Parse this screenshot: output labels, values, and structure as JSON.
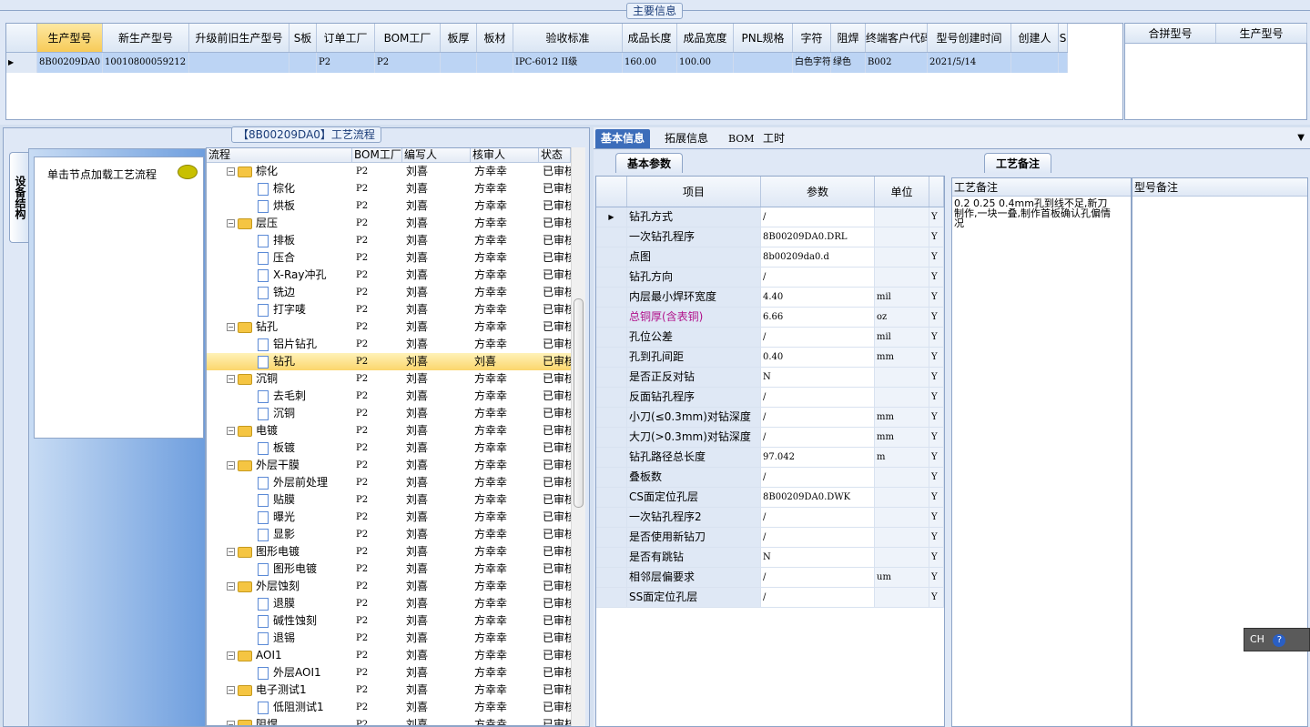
{
  "main_info": {
    "title": "主要信息",
    "columns": [
      "生产型号",
      "新生产型号",
      "升级前旧生产型号",
      "S板",
      "订单工厂",
      "BOM工厂",
      "板厚",
      "板材",
      "验收标准",
      "成品长度",
      "成品宽度",
      "PNL规格",
      "字符",
      "阻焊",
      "终端客户代码",
      "型号创建时间",
      "创建人",
      "S"
    ],
    "row": [
      "8B00209DA0",
      "10010800059212",
      "",
      "",
      "P2",
      "P2",
      "",
      "",
      "IPC-6012 II级",
      "160.00",
      "100.00",
      "",
      "白色字符",
      "绿色",
      "B002",
      "2021/5/14",
      "",
      ""
    ]
  },
  "merge": {
    "columns": [
      "合拼型号",
      "生产型号"
    ]
  },
  "process_flow": {
    "title": "【8B00209DA0】工艺流程",
    "side_tab": "设备结构",
    "hint": "单击节点加载工艺流程",
    "headers": [
      "流程",
      "BOM工厂",
      "编写人",
      "核审人",
      "状态"
    ],
    "rows": [
      {
        "name": "棕化",
        "level": 0,
        "factory": "P2",
        "writer": "刘喜",
        "reviewer": "方幸幸",
        "status": "已审核"
      },
      {
        "name": "棕化",
        "level": 1,
        "factory": "P2",
        "writer": "刘喜",
        "reviewer": "方幸幸",
        "status": "已审核"
      },
      {
        "name": "烘板",
        "level": 1,
        "factory": "P2",
        "writer": "刘喜",
        "reviewer": "方幸幸",
        "status": "已审核"
      },
      {
        "name": "层压",
        "level": 0,
        "factory": "P2",
        "writer": "刘喜",
        "reviewer": "方幸幸",
        "status": "已审核"
      },
      {
        "name": "排板",
        "level": 1,
        "factory": "P2",
        "writer": "刘喜",
        "reviewer": "方幸幸",
        "status": "已审核"
      },
      {
        "name": "压合",
        "level": 1,
        "factory": "P2",
        "writer": "刘喜",
        "reviewer": "方幸幸",
        "status": "已审核"
      },
      {
        "name": "X-Ray冲孔",
        "level": 1,
        "factory": "P2",
        "writer": "刘喜",
        "reviewer": "方幸幸",
        "status": "已审核"
      },
      {
        "name": "铣边",
        "level": 1,
        "factory": "P2",
        "writer": "刘喜",
        "reviewer": "方幸幸",
        "status": "已审核"
      },
      {
        "name": "打字唛",
        "level": 1,
        "factory": "P2",
        "writer": "刘喜",
        "reviewer": "方幸幸",
        "status": "已审核"
      },
      {
        "name": "钻孔",
        "level": 0,
        "factory": "P2",
        "writer": "刘喜",
        "reviewer": "方幸幸",
        "status": "已审核"
      },
      {
        "name": "铝片钻孔",
        "level": 1,
        "factory": "P2",
        "writer": "刘喜",
        "reviewer": "方幸幸",
        "status": "已审核"
      },
      {
        "name": "钻孔",
        "level": 1,
        "factory": "P2",
        "writer": "刘喜",
        "reviewer": "刘喜",
        "status": "已审核",
        "selected": true
      },
      {
        "name": "沉铜",
        "level": 0,
        "factory": "P2",
        "writer": "刘喜",
        "reviewer": "方幸幸",
        "status": "已审核"
      },
      {
        "name": "去毛刺",
        "level": 1,
        "factory": "P2",
        "writer": "刘喜",
        "reviewer": "方幸幸",
        "status": "已审核"
      },
      {
        "name": "沉铜",
        "level": 1,
        "factory": "P2",
        "writer": "刘喜",
        "reviewer": "方幸幸",
        "status": "已审核"
      },
      {
        "name": "电镀",
        "level": 0,
        "factory": "P2",
        "writer": "刘喜",
        "reviewer": "方幸幸",
        "status": "已审核"
      },
      {
        "name": "板镀",
        "level": 1,
        "factory": "P2",
        "writer": "刘喜",
        "reviewer": "方幸幸",
        "status": "已审核"
      },
      {
        "name": "外层干膜",
        "level": 0,
        "factory": "P2",
        "writer": "刘喜",
        "reviewer": "方幸幸",
        "status": "已审核"
      },
      {
        "name": "外层前处理",
        "level": 1,
        "factory": "P2",
        "writer": "刘喜",
        "reviewer": "方幸幸",
        "status": "已审核"
      },
      {
        "name": "贴膜",
        "level": 1,
        "factory": "P2",
        "writer": "刘喜",
        "reviewer": "方幸幸",
        "status": "已审核"
      },
      {
        "name": "曝光",
        "level": 1,
        "factory": "P2",
        "writer": "刘喜",
        "reviewer": "方幸幸",
        "status": "已审核"
      },
      {
        "name": "显影",
        "level": 1,
        "factory": "P2",
        "writer": "刘喜",
        "reviewer": "方幸幸",
        "status": "已审核"
      },
      {
        "name": "图形电镀",
        "level": 0,
        "factory": "P2",
        "writer": "刘喜",
        "reviewer": "方幸幸",
        "status": "已审核"
      },
      {
        "name": "图形电镀",
        "level": 1,
        "factory": "P2",
        "writer": "刘喜",
        "reviewer": "方幸幸",
        "status": "已审核"
      },
      {
        "name": "外层蚀刻",
        "level": 0,
        "factory": "P2",
        "writer": "刘喜",
        "reviewer": "方幸幸",
        "status": "已审核"
      },
      {
        "name": "退膜",
        "level": 1,
        "factory": "P2",
        "writer": "刘喜",
        "reviewer": "方幸幸",
        "status": "已审核"
      },
      {
        "name": "碱性蚀刻",
        "level": 1,
        "factory": "P2",
        "writer": "刘喜",
        "reviewer": "方幸幸",
        "status": "已审核"
      },
      {
        "name": "退锡",
        "level": 1,
        "factory": "P2",
        "writer": "刘喜",
        "reviewer": "方幸幸",
        "status": "已审核"
      },
      {
        "name": "AOI1",
        "level": 0,
        "factory": "P2",
        "writer": "刘喜",
        "reviewer": "方幸幸",
        "status": "已审核"
      },
      {
        "name": "外层AOI1",
        "level": 1,
        "factory": "P2",
        "writer": "刘喜",
        "reviewer": "方幸幸",
        "status": "已审核"
      },
      {
        "name": "电子测试1",
        "level": 0,
        "factory": "P2",
        "writer": "刘喜",
        "reviewer": "方幸幸",
        "status": "已审核"
      },
      {
        "name": "低阻测试1",
        "level": 1,
        "factory": "P2",
        "writer": "刘喜",
        "reviewer": "方幸幸",
        "status": "已审核"
      },
      {
        "name": "阻焊",
        "level": 0,
        "factory": "P2",
        "writer": "刘喜",
        "reviewer": "方幸幸",
        "status": "已审核"
      }
    ]
  },
  "tabs": [
    "基本信息",
    "拓展信息",
    "BOM",
    "工时"
  ],
  "basic_params": {
    "title": "基本参数",
    "headers": [
      "项目",
      "参数",
      "单位"
    ],
    "rows": [
      {
        "item": "钻孔方式",
        "value": "/",
        "unit": "",
        "flag": "Y"
      },
      {
        "item": "一次钻孔程序",
        "value": "8B00209DA0.DRL",
        "unit": "",
        "flag": "Y"
      },
      {
        "item": "点图",
        "value": "8b00209da0.d",
        "unit": "",
        "flag": "Y"
      },
      {
        "item": "钻孔方向",
        "value": "/",
        "unit": "",
        "flag": "Y"
      },
      {
        "item": "内层最小焊环宽度",
        "value": "4.40",
        "unit": "mil",
        "flag": "Y"
      },
      {
        "item": "总铜厚(含表铜)",
        "value": "6.66",
        "unit": "oz",
        "flag": "Y",
        "highlight": true
      },
      {
        "item": "孔位公差",
        "value": "/",
        "unit": "mil",
        "flag": "Y"
      },
      {
        "item": "孔到孔间距",
        "value": "0.40",
        "unit": "mm",
        "flag": "Y"
      },
      {
        "item": "是否正反对钻",
        "value": "N",
        "unit": "",
        "flag": "Y"
      },
      {
        "item": "反面钻孔程序",
        "value": "/",
        "unit": "",
        "flag": "Y"
      },
      {
        "item": "小刀(≤0.3mm)对钻深度",
        "value": "/",
        "unit": "mm",
        "flag": "Y"
      },
      {
        "item": "大刀(>0.3mm)对钻深度",
        "value": "/",
        "unit": "mm",
        "flag": "Y"
      },
      {
        "item": "钻孔路径总长度",
        "value": "97.042",
        "unit": "m",
        "flag": "Y"
      },
      {
        "item": "叠板数",
        "value": "/",
        "unit": "",
        "flag": "Y"
      },
      {
        "item": "CS面定位孔层",
        "value": "8B00209DA0.DWK",
        "unit": "",
        "flag": "Y"
      },
      {
        "item": "一次钻孔程序2",
        "value": "/",
        "unit": "",
        "flag": "Y"
      },
      {
        "item": "是否使用新钻刀",
        "value": "/",
        "unit": "",
        "flag": "Y"
      },
      {
        "item": "是否有跳钻",
        "value": "N",
        "unit": "",
        "flag": "Y"
      },
      {
        "item": "相邻层偏要求",
        "value": "/",
        "unit": "um",
        "flag": "Y"
      },
      {
        "item": "SS面定位孔层",
        "value": "/",
        "unit": "",
        "flag": "Y"
      }
    ]
  },
  "notes": {
    "title": "工艺备注",
    "process_note_header": "工艺备注",
    "model_note_header": "型号备注",
    "process_note": "0.2 0.25 0.4mm孔到线不足,新刀制作,一块一叠,制作首板确认孔偏情况"
  },
  "ime": {
    "label": "CH",
    "help": "?"
  }
}
